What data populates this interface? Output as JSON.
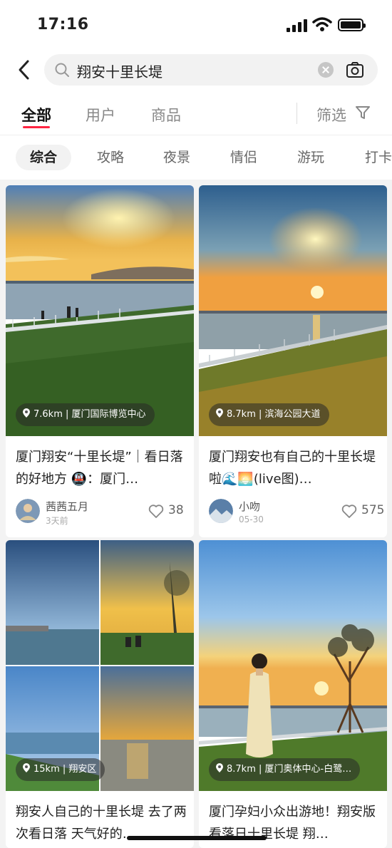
{
  "status": {
    "time": "17:16"
  },
  "search": {
    "query": "翔安十里长堤"
  },
  "tabs": [
    {
      "label": "全部"
    },
    {
      "label": "用户"
    },
    {
      "label": "商品"
    }
  ],
  "filter": {
    "label": "筛选"
  },
  "chips": [
    "综合",
    "攻略",
    "夜景",
    "情侣",
    "游玩",
    "打卡"
  ],
  "cards": [
    {
      "location": "7.6km | 厦门国际博览中心",
      "title": "厦门翔安“十里长堤”｜看日落的好地方 🚇：厦门…",
      "user": "茜茜五月",
      "date": "3天前",
      "likes": "38"
    },
    {
      "location": "8.7km | 滨海公园大道",
      "title": "厦门翔安也有自己的十里长堤啦🌊🌅(live图)…",
      "user": "小吻",
      "date": "05-30",
      "likes": "575"
    },
    {
      "location": "15km | 翔安区",
      "title": "翔安人自己的十里长堤 去了两次看日落 天气好的…"
    },
    {
      "location": "8.7km | 厦门奥体中心-白鹭…",
      "title": "厦门孕妇小众出游地！翔安版看落日十里长堤 翔…"
    }
  ]
}
